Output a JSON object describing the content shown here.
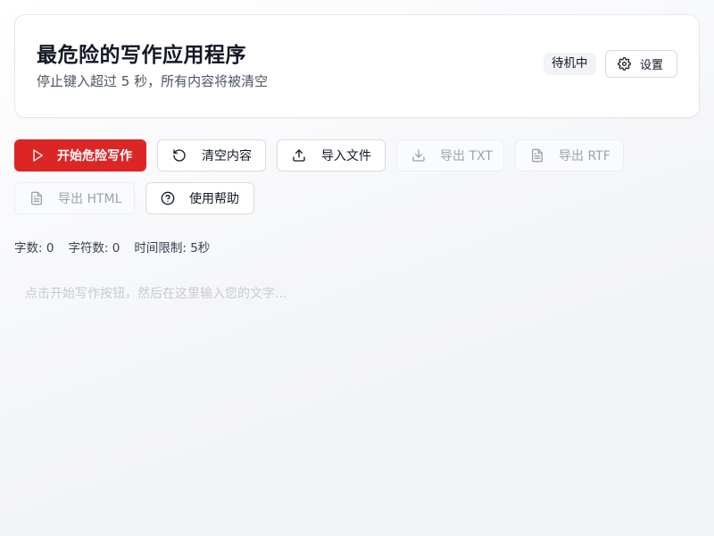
{
  "header": {
    "title": "最危险的写作应用程序",
    "subtitle": "停止键入超过 5 秒，所有内容将被清空",
    "status": "待机中",
    "settings_label": "设置"
  },
  "toolbar": {
    "start_label": "开始危险写作",
    "clear_label": "清空内容",
    "import_label": "导入文件",
    "export_txt_label": "导出 TXT",
    "export_rtf_label": "导出 RTF",
    "export_html_label": "导出 HTML",
    "help_label": "使用帮助"
  },
  "stats": {
    "words": "字数: 0",
    "chars": "字符数: 0",
    "time_limit": "时间限制: 5秒"
  },
  "editor": {
    "placeholder": "点击开始写作按钮，然后在这里输入您的文字..."
  },
  "colors": {
    "accent": "#dc2626",
    "disabled_text": "#9ca3af"
  },
  "icons": {
    "start": "play-icon",
    "clear": "rotate-ccw-icon",
    "import": "upload-icon",
    "export_txt": "download-icon",
    "export_rtf": "file-text-icon",
    "export_html": "file-text-icon",
    "help": "help-circle-icon",
    "settings": "gear-icon"
  }
}
